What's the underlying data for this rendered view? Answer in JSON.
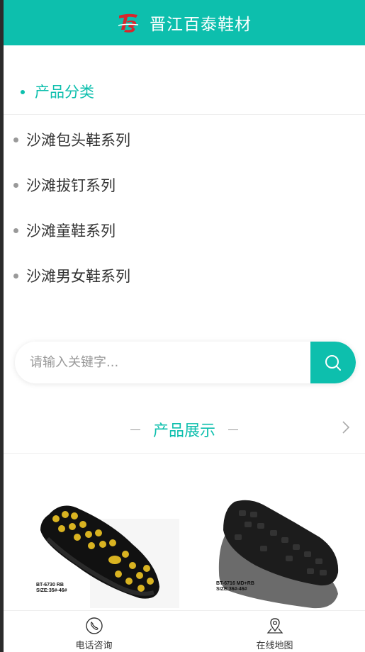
{
  "header": {
    "title": "晋江百泰鞋材",
    "logo": "TB-logo"
  },
  "categories": {
    "heading": "产品分类",
    "items": [
      {
        "label": "沙滩包头鞋系列"
      },
      {
        "label": "沙滩拔钉系列"
      },
      {
        "label": "沙滩童鞋系列"
      },
      {
        "label": "沙滩男女鞋系列"
      }
    ]
  },
  "search": {
    "placeholder": "请输入关键字...",
    "button_icon": "search-icon"
  },
  "showcase": {
    "heading": "产品展示",
    "more_icon": "chevron-right-icon",
    "products": [
      {
        "code_line1": "BT-6730 RB",
        "code_line2": "SIZE:35#-46#"
      },
      {
        "code_line1": "BT-6716  MD+RB",
        "code_line2": "SIZE:36#-46#"
      }
    ]
  },
  "bottom_nav": [
    {
      "label": "电话咨询",
      "icon": "phone-icon"
    },
    {
      "label": "在线地图",
      "icon": "map-pin-icon"
    }
  ],
  "colors": {
    "accent": "#0dbfad",
    "bullet": "#999999",
    "text": "#333333"
  }
}
